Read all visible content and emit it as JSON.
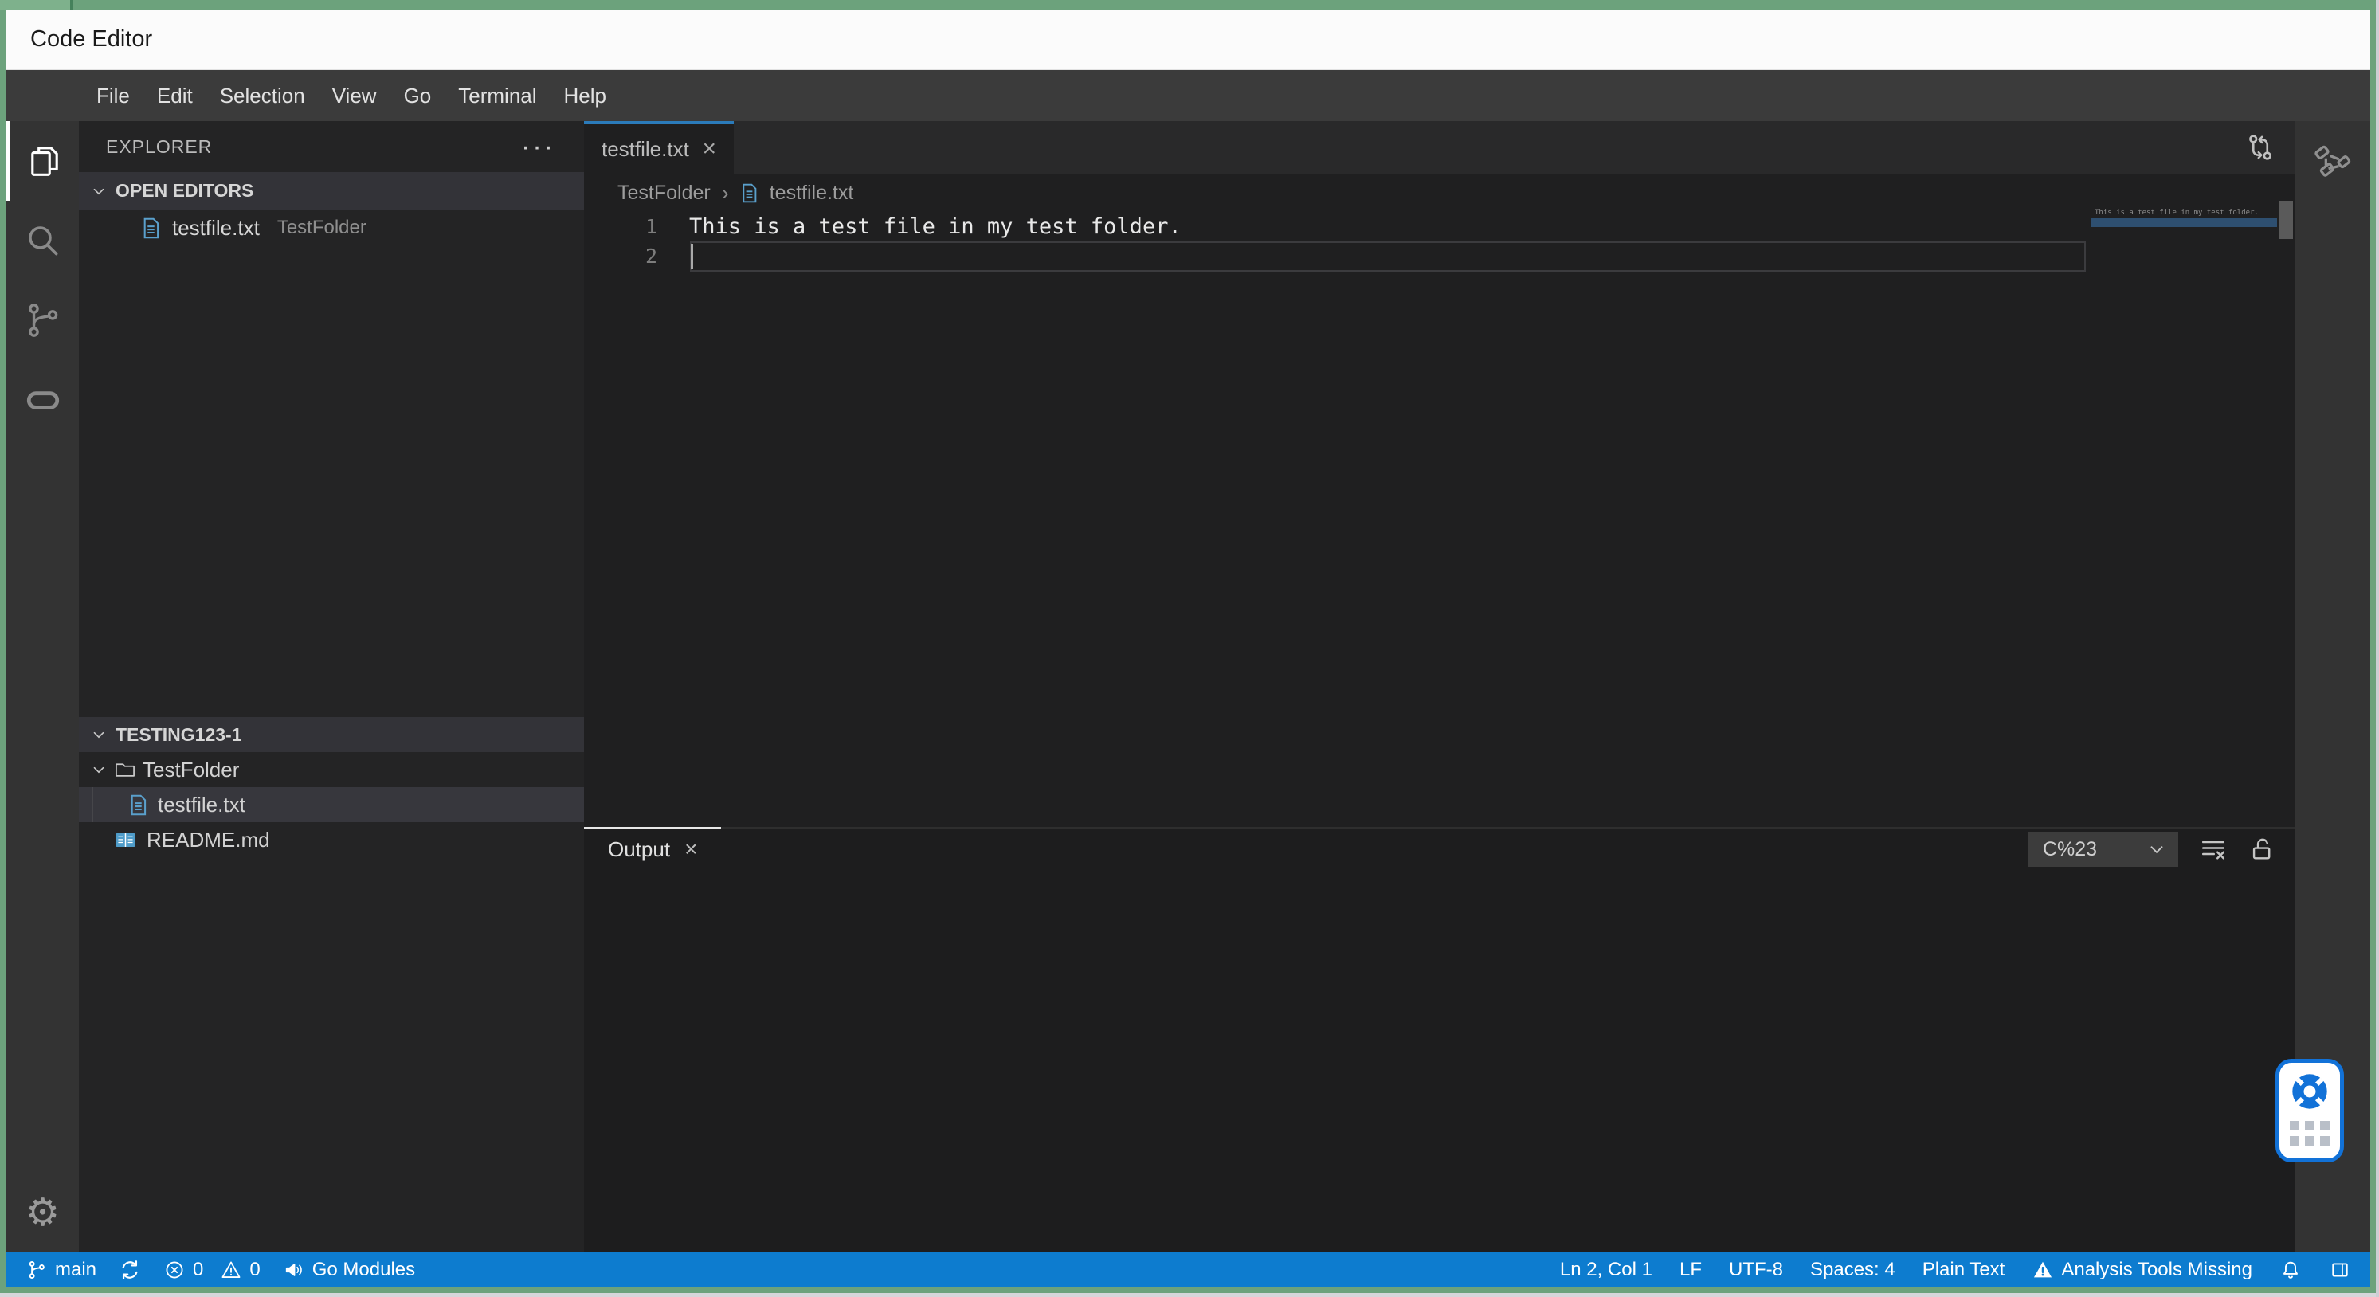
{
  "window": {
    "title": "Code Editor"
  },
  "menu": {
    "items": [
      "File",
      "Edit",
      "Selection",
      "View",
      "Go",
      "Terminal",
      "Help"
    ]
  },
  "activity_bar": {
    "items": [
      {
        "icon": "files-icon",
        "active": true
      },
      {
        "icon": "search-icon",
        "active": false
      },
      {
        "icon": "source-control-icon",
        "active": false
      },
      {
        "icon": "extensions-oval-icon",
        "active": false
      }
    ],
    "bottom": [
      {
        "icon": "gear-icon",
        "glyph": "⚙"
      }
    ]
  },
  "explorer": {
    "title": "EXPLORER",
    "actions": "···",
    "open_editors": {
      "label": "OPEN EDITORS",
      "items": [
        {
          "file": "testfile.txt",
          "description": "TestFolder",
          "icon": "file-text-icon"
        }
      ]
    },
    "workspace": {
      "label": "TESTING123-1",
      "folder": {
        "name": "TestFolder",
        "icon": "folder-icon",
        "expanded": true
      },
      "folder_children": [
        {
          "file": "testfile.txt",
          "icon": "file-text-icon",
          "selected": true
        }
      ],
      "root_files": [
        {
          "file": "README.md",
          "icon": "markdown-book-icon"
        }
      ]
    }
  },
  "editor": {
    "tab": {
      "label": "testfile.txt",
      "close": "×",
      "active": true
    },
    "actions": [
      {
        "icon": "compare-changes-icon"
      }
    ],
    "breadcrumb": {
      "folder": "TestFolder",
      "separator": "›",
      "file": "testfile.txt",
      "file_icon": "file-text-icon"
    },
    "lines": [
      {
        "number": "1",
        "text": "This is a test file in my test folder."
      },
      {
        "number": "2",
        "text": ""
      }
    ],
    "minimap_text": "This is a test file in my test folder.",
    "cursor": {
      "line": 2,
      "col": 1
    }
  },
  "panel": {
    "tab": {
      "label": "Output",
      "close": "×",
      "active": true
    },
    "channel_select": {
      "value": "C%23",
      "icon": "chevron-down-icon"
    },
    "actions": [
      {
        "icon": "clear-output-icon"
      },
      {
        "icon": "unlock-icon"
      }
    ]
  },
  "secondary_bar": {
    "items": [
      {
        "icon": "workflow-icon"
      }
    ]
  },
  "status_bar": {
    "left": [
      {
        "icon": "git-branch-icon",
        "label": "main"
      },
      {
        "icon": "sync-icon",
        "label": ""
      },
      {
        "icon": "error-icon",
        "label": "0"
      },
      {
        "icon": "warning-icon",
        "label": "0"
      },
      {
        "icon": "megaphone-icon",
        "label": "Go Modules"
      }
    ],
    "right": [
      {
        "label": "Ln 2, Col 1"
      },
      {
        "label": "LF"
      },
      {
        "label": "UTF-8"
      },
      {
        "label": "Spaces: 4"
      },
      {
        "label": "Plain Text"
      },
      {
        "icon": "warning-filled-icon",
        "label": "Analysis Tools Missing"
      },
      {
        "icon": "bell-icon",
        "label": ""
      },
      {
        "icon": "layout-icon",
        "label": ""
      }
    ]
  },
  "help_widget": {
    "icon": "lifebuoy-icon",
    "handle_icon": "drag-dots-icon"
  },
  "colors": {
    "frame_green": "#6ca27c",
    "statusbar_blue": "#0d7ccf",
    "tab_accent_blue": "#2b7bba",
    "file_icon_blue": "#5aa0cc",
    "widget_blue": "#1272d8",
    "minimap_highlight": "#2e4f70"
  }
}
